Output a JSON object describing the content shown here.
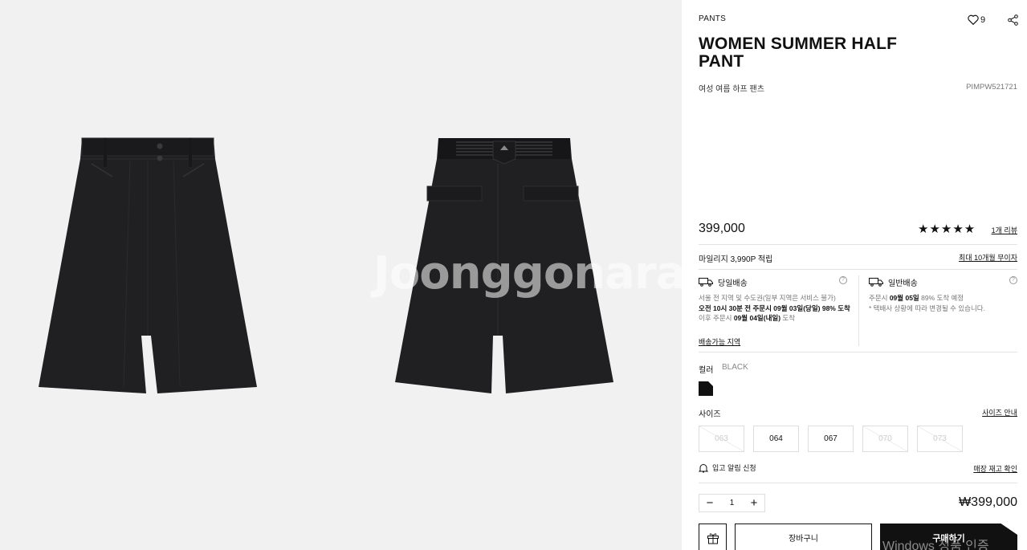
{
  "gallery": {
    "watermark": "Joonggonara"
  },
  "product": {
    "category": "PANTS",
    "wish_count": "9",
    "title": "WOMEN SUMMER HALF PANT",
    "subtitle": "여성 여름 하프 팬츠",
    "code": "PIMPW521721",
    "price": "399,000",
    "stars": "★★★★★",
    "review_link": "1개 리뷰",
    "mileage": "마일리지 3,990P 적립",
    "installment_link": "최대 10개월 무이자"
  },
  "shipping": {
    "same_day": {
      "title": "당일배송",
      "line1": "서울 전 지역 및 수도권(일부 지역은 서비스 불가)",
      "line2": "오전 10시 30분 전 주문시 09월 03일(당일) 98% 도착",
      "line3_a": "이후 주문시 ",
      "line3_b": "09월 04일(내일)",
      "line3_c": " 도착"
    },
    "standard": {
      "title": "일반배송",
      "line1_a": "주문시 ",
      "line1_b": "09월 05일",
      "line1_c": " 89% 도착 예정",
      "line2": "* 택배사 상황에 따라 변경될 수 있습니다."
    },
    "area_link": "배송가능 지역"
  },
  "options": {
    "color_label": "컬러",
    "color_value": "BLACK",
    "swatch_color": "#111111",
    "size_label": "사이즈",
    "size_guide": "사이즈 안내",
    "sizes": [
      {
        "label": "063",
        "available": false
      },
      {
        "label": "064",
        "available": true
      },
      {
        "label": "067",
        "available": true
      },
      {
        "label": "070",
        "available": false
      },
      {
        "label": "073",
        "available": false
      }
    ],
    "restock_label": "입고 알림 신청",
    "store_stock_link": "매장 재고 확인"
  },
  "order": {
    "quantity": "1",
    "total": "₩399,000",
    "cart_label": "장바구니",
    "buy_label": "구매하기"
  },
  "overlay": {
    "windows_text": "Windows 정품 인증"
  }
}
